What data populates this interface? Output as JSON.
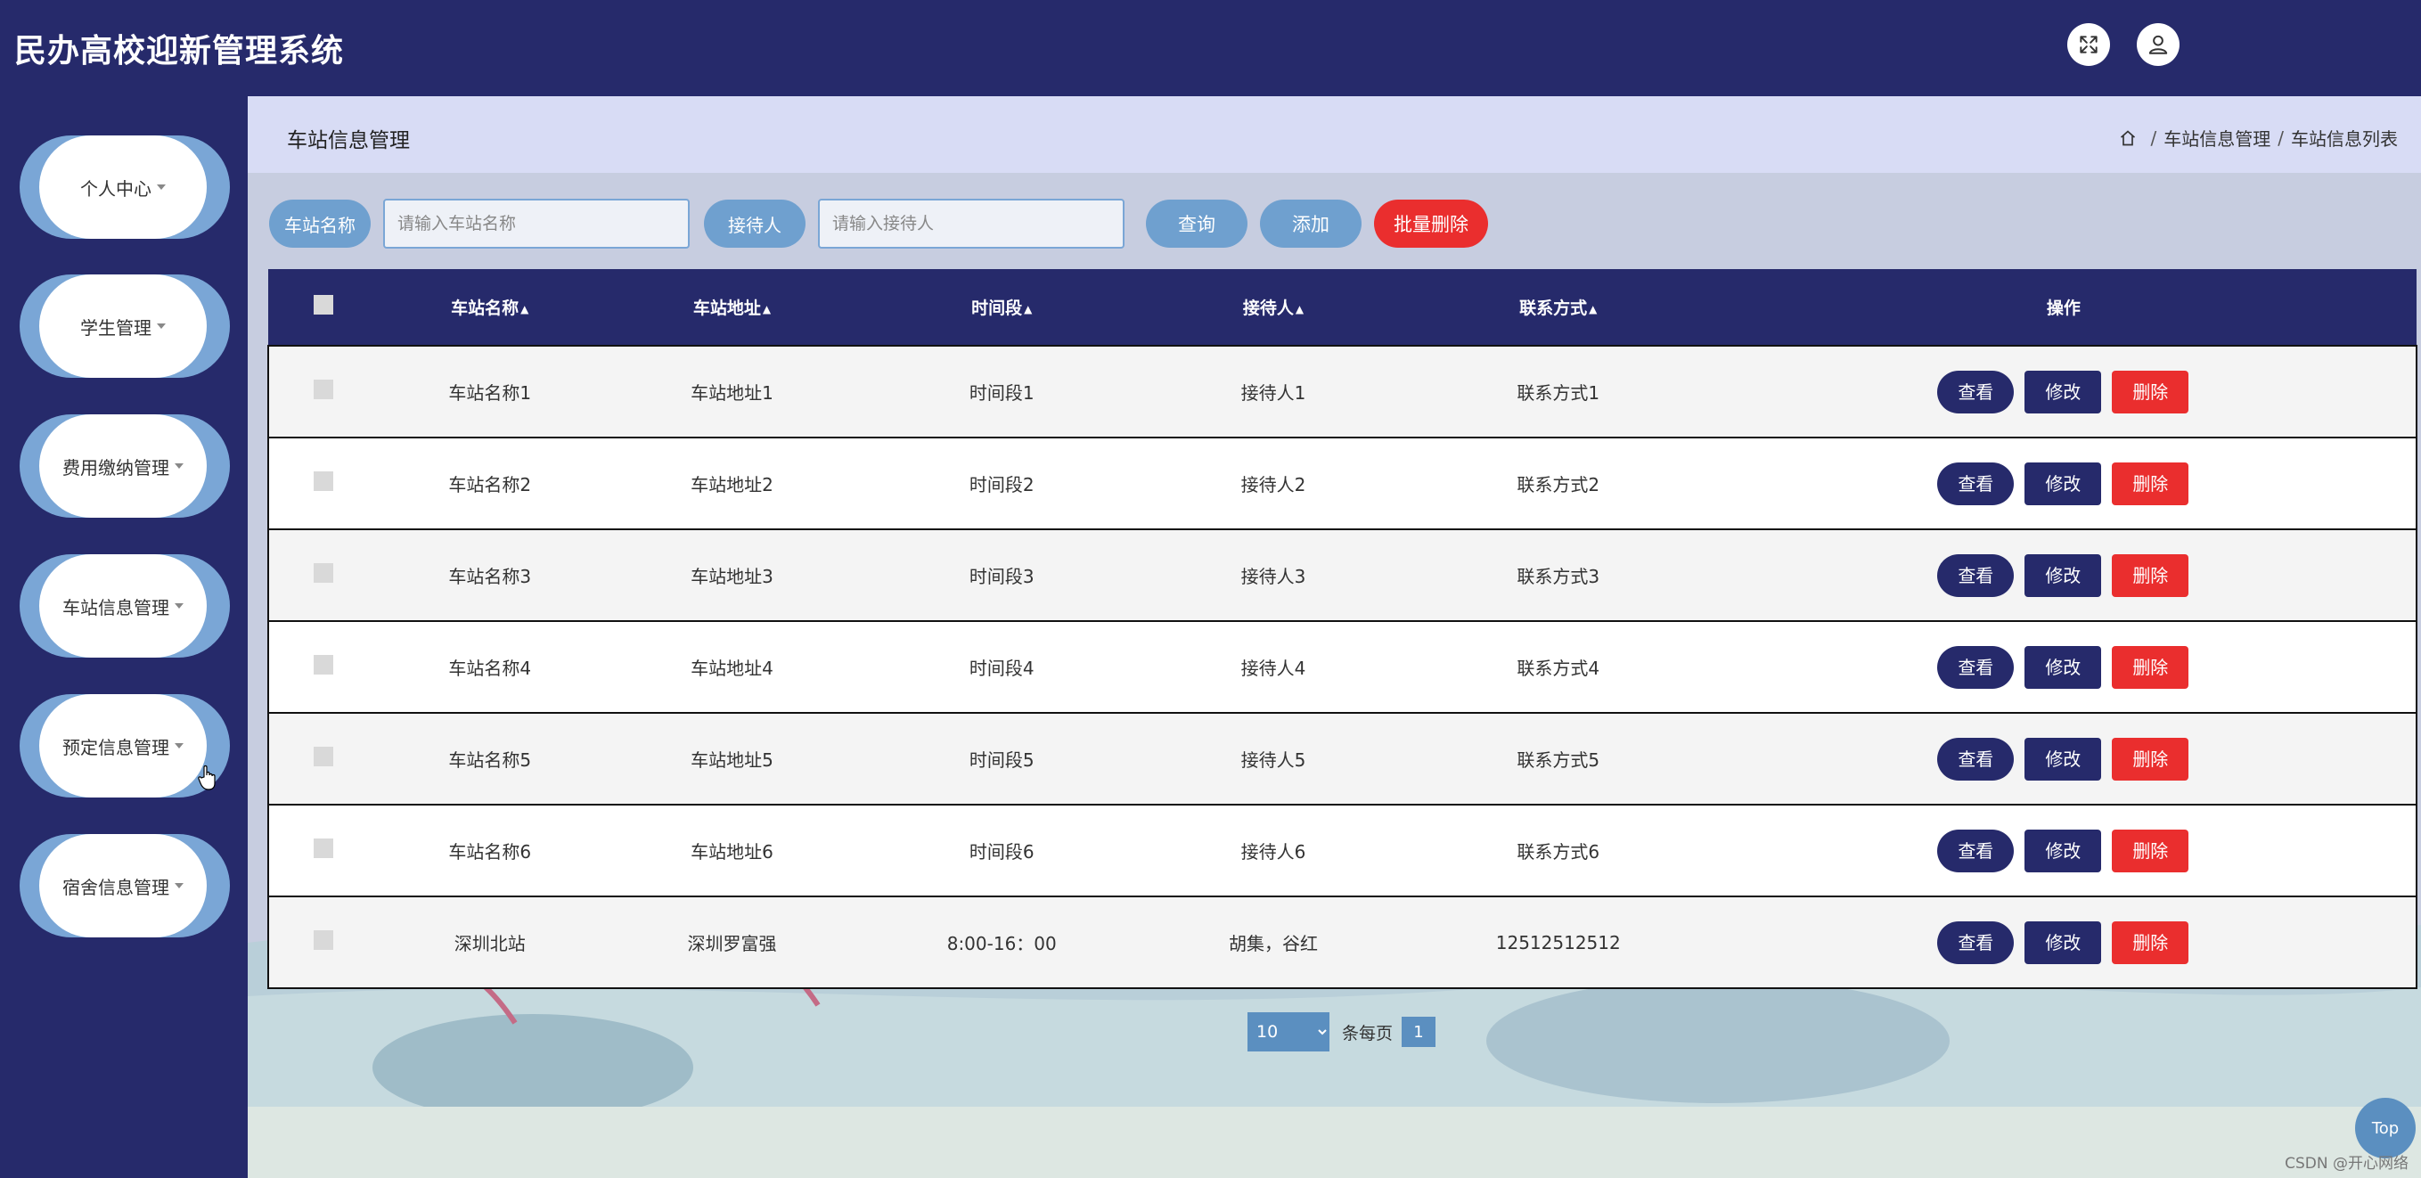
{
  "header": {
    "title": "民办高校迎新管理系统",
    "fullscreen_icon": "expand-icon",
    "user_icon": "user-icon"
  },
  "sidebar": {
    "items": [
      {
        "label": "个人中心"
      },
      {
        "label": "学生管理"
      },
      {
        "label": "费用缴纳管理"
      },
      {
        "label": "车站信息管理"
      },
      {
        "label": "预定信息管理"
      },
      {
        "label": "宿舍信息管理"
      }
    ]
  },
  "content": {
    "page_title": "车站信息管理",
    "breadcrumb": [
      "车站信息管理",
      "车站信息列表"
    ]
  },
  "search": {
    "station_label": "车站名称",
    "station_placeholder": "请输入车站名称",
    "receiver_label": "接待人",
    "receiver_placeholder": "请输入接待人",
    "query_label": "查询",
    "add_label": "添加",
    "batch_delete_label": "批量删除"
  },
  "table": {
    "headers": [
      "车站名称",
      "车站地址",
      "时间段",
      "接待人",
      "联系方式",
      "操作"
    ],
    "rows": [
      [
        "车站名称1",
        "车站地址1",
        "时间段1",
        "接待人1",
        "联系方式1"
      ],
      [
        "车站名称2",
        "车站地址2",
        "时间段2",
        "接待人2",
        "联系方式2"
      ],
      [
        "车站名称3",
        "车站地址3",
        "时间段3",
        "接待人3",
        "联系方式3"
      ],
      [
        "车站名称4",
        "车站地址4",
        "时间段4",
        "接待人4",
        "联系方式4"
      ],
      [
        "车站名称5",
        "车站地址5",
        "时间段5",
        "接待人5",
        "联系方式5"
      ],
      [
        "车站名称6",
        "车站地址6",
        "时间段6",
        "接待人6",
        "联系方式6"
      ],
      [
        "深圳北站",
        "深圳罗富强",
        "8:00-16：00",
        "胡集，谷红",
        "12512512512"
      ]
    ],
    "actions": {
      "view": "查看",
      "edit": "修改",
      "delete": "删除"
    }
  },
  "pager": {
    "page_size": "10",
    "per_page_label": "条每页",
    "current_page": "1"
  },
  "top_button": "Top",
  "watermark": "CSDN @开心网络",
  "colors": {
    "primary": "#262a6b",
    "accent": "#7aa6d6",
    "danger": "#ea2e2e"
  }
}
